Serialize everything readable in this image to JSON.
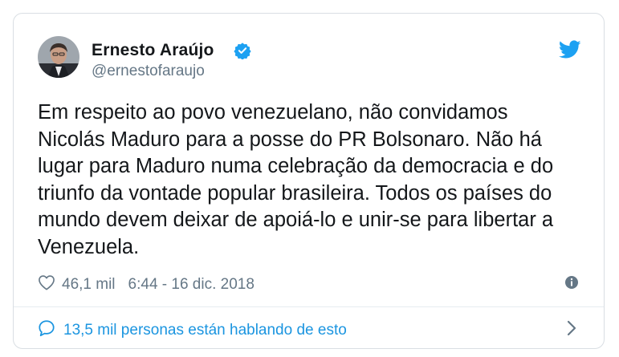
{
  "tweet": {
    "display_name": "Ernesto Araújo",
    "handle": "@ernestofaraujo",
    "verified": true,
    "text": "Em respeito ao povo venezuelano, não convidamos\nNicolás Maduro para a posse do PR Bolsonaro. Não há\nlugar para Maduro numa celebração da democracia e do\ntriunfo da vontade popular brasileira. Todos os países do\nmundo devem deixar de apoiá-lo e unir-se para libertar a\nVenezuela.",
    "likes": "46,1 mil",
    "timestamp": "6:44 - 16 dic. 2018",
    "conversation_label": "13,5 mil personas están hablando de esto"
  },
  "icons": {
    "brand": "twitter-bird-icon",
    "verified": "verified-badge-icon",
    "like": "heart-icon",
    "info": "info-icon",
    "conversation": "speech-bubble-icon",
    "more": "chevron-right-icon"
  },
  "colors": {
    "brand_blue": "#1da1f2",
    "link_blue": "#1b95e0",
    "text_primary": "#14171a",
    "text_secondary": "#657786",
    "border": "#d9dee3"
  }
}
